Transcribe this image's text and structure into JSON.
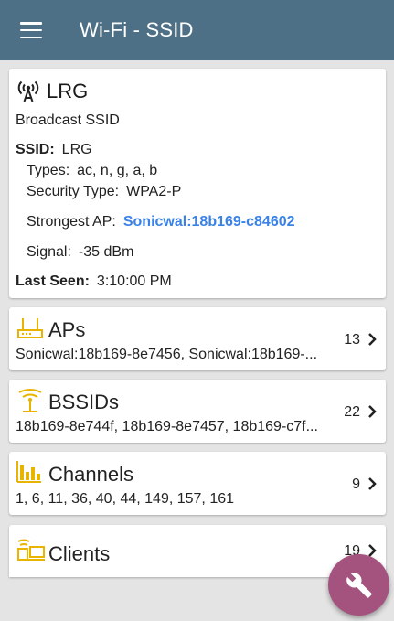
{
  "appbar": {
    "title": "Wi-Fi - SSID",
    "menu_icon": "hamburger-menu-icon"
  },
  "summary": {
    "icon": "broadcast-antenna-icon",
    "name": "LRG",
    "subtitle": "Broadcast SSID",
    "ssid_label": "SSID:",
    "ssid_value": "LRG",
    "types_label": "Types:",
    "types_value": "ac, n, g, a, b",
    "security_label": "Security Type:",
    "security_value": "WPA2-P",
    "strongest_label": "Strongest AP:",
    "strongest_value": "Sonicwal:18b169-c84602",
    "signal_label": "Signal:",
    "signal_value": "-35 dBm",
    "lastseen_label": "Last Seen:",
    "lastseen_value": "3:10:00 PM"
  },
  "cards": [
    {
      "icon": "access-point-icon",
      "title": "APs",
      "subtitle": "Sonicwal:18b169-8e7456, Sonicwal:18b169-...",
      "count": "13"
    },
    {
      "icon": "bssid-antenna-icon",
      "title": "BSSIDs",
      "subtitle": "18b169-8e744f, 18b169-8e7457, 18b169-c7f...",
      "count": "22"
    },
    {
      "icon": "bar-chart-icon",
      "title": "Channels",
      "subtitle": "1, 6, 11, 36, 40, 44, 149, 157, 161",
      "count": "9"
    },
    {
      "icon": "clients-devices-icon",
      "title": "Clients",
      "subtitle": "",
      "count": "19"
    }
  ],
  "fab": {
    "icon": "wrench-icon"
  },
  "colors": {
    "appbar": "#4d7086",
    "accent_icon": "#e8b400",
    "link": "#3b82e6",
    "fab": "#a4527e"
  }
}
